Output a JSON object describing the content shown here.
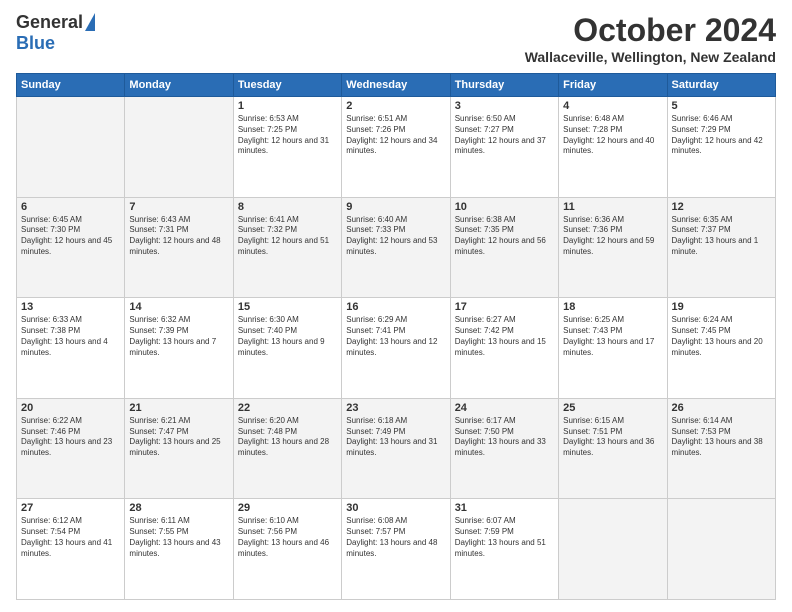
{
  "logo": {
    "general": "General",
    "blue": "Blue"
  },
  "title": {
    "month": "October 2024",
    "location": "Wallaceville, Wellington, New Zealand"
  },
  "weekdays": [
    "Sunday",
    "Monday",
    "Tuesday",
    "Wednesday",
    "Thursday",
    "Friday",
    "Saturday"
  ],
  "weeks": [
    [
      {
        "day": "",
        "info": ""
      },
      {
        "day": "",
        "info": ""
      },
      {
        "day": "1",
        "info": "Sunrise: 6:53 AM\nSunset: 7:25 PM\nDaylight: 12 hours and 31 minutes."
      },
      {
        "day": "2",
        "info": "Sunrise: 6:51 AM\nSunset: 7:26 PM\nDaylight: 12 hours and 34 minutes."
      },
      {
        "day": "3",
        "info": "Sunrise: 6:50 AM\nSunset: 7:27 PM\nDaylight: 12 hours and 37 minutes."
      },
      {
        "day": "4",
        "info": "Sunrise: 6:48 AM\nSunset: 7:28 PM\nDaylight: 12 hours and 40 minutes."
      },
      {
        "day": "5",
        "info": "Sunrise: 6:46 AM\nSunset: 7:29 PM\nDaylight: 12 hours and 42 minutes."
      }
    ],
    [
      {
        "day": "6",
        "info": "Sunrise: 6:45 AM\nSunset: 7:30 PM\nDaylight: 12 hours and 45 minutes."
      },
      {
        "day": "7",
        "info": "Sunrise: 6:43 AM\nSunset: 7:31 PM\nDaylight: 12 hours and 48 minutes."
      },
      {
        "day": "8",
        "info": "Sunrise: 6:41 AM\nSunset: 7:32 PM\nDaylight: 12 hours and 51 minutes."
      },
      {
        "day": "9",
        "info": "Sunrise: 6:40 AM\nSunset: 7:33 PM\nDaylight: 12 hours and 53 minutes."
      },
      {
        "day": "10",
        "info": "Sunrise: 6:38 AM\nSunset: 7:35 PM\nDaylight: 12 hours and 56 minutes."
      },
      {
        "day": "11",
        "info": "Sunrise: 6:36 AM\nSunset: 7:36 PM\nDaylight: 12 hours and 59 minutes."
      },
      {
        "day": "12",
        "info": "Sunrise: 6:35 AM\nSunset: 7:37 PM\nDaylight: 13 hours and 1 minute."
      }
    ],
    [
      {
        "day": "13",
        "info": "Sunrise: 6:33 AM\nSunset: 7:38 PM\nDaylight: 13 hours and 4 minutes."
      },
      {
        "day": "14",
        "info": "Sunrise: 6:32 AM\nSunset: 7:39 PM\nDaylight: 13 hours and 7 minutes."
      },
      {
        "day": "15",
        "info": "Sunrise: 6:30 AM\nSunset: 7:40 PM\nDaylight: 13 hours and 9 minutes."
      },
      {
        "day": "16",
        "info": "Sunrise: 6:29 AM\nSunset: 7:41 PM\nDaylight: 13 hours and 12 minutes."
      },
      {
        "day": "17",
        "info": "Sunrise: 6:27 AM\nSunset: 7:42 PM\nDaylight: 13 hours and 15 minutes."
      },
      {
        "day": "18",
        "info": "Sunrise: 6:25 AM\nSunset: 7:43 PM\nDaylight: 13 hours and 17 minutes."
      },
      {
        "day": "19",
        "info": "Sunrise: 6:24 AM\nSunset: 7:45 PM\nDaylight: 13 hours and 20 minutes."
      }
    ],
    [
      {
        "day": "20",
        "info": "Sunrise: 6:22 AM\nSunset: 7:46 PM\nDaylight: 13 hours and 23 minutes."
      },
      {
        "day": "21",
        "info": "Sunrise: 6:21 AM\nSunset: 7:47 PM\nDaylight: 13 hours and 25 minutes."
      },
      {
        "day": "22",
        "info": "Sunrise: 6:20 AM\nSunset: 7:48 PM\nDaylight: 13 hours and 28 minutes."
      },
      {
        "day": "23",
        "info": "Sunrise: 6:18 AM\nSunset: 7:49 PM\nDaylight: 13 hours and 31 minutes."
      },
      {
        "day": "24",
        "info": "Sunrise: 6:17 AM\nSunset: 7:50 PM\nDaylight: 13 hours and 33 minutes."
      },
      {
        "day": "25",
        "info": "Sunrise: 6:15 AM\nSunset: 7:51 PM\nDaylight: 13 hours and 36 minutes."
      },
      {
        "day": "26",
        "info": "Sunrise: 6:14 AM\nSunset: 7:53 PM\nDaylight: 13 hours and 38 minutes."
      }
    ],
    [
      {
        "day": "27",
        "info": "Sunrise: 6:12 AM\nSunset: 7:54 PM\nDaylight: 13 hours and 41 minutes."
      },
      {
        "day": "28",
        "info": "Sunrise: 6:11 AM\nSunset: 7:55 PM\nDaylight: 13 hours and 43 minutes."
      },
      {
        "day": "29",
        "info": "Sunrise: 6:10 AM\nSunset: 7:56 PM\nDaylight: 13 hours and 46 minutes."
      },
      {
        "day": "30",
        "info": "Sunrise: 6:08 AM\nSunset: 7:57 PM\nDaylight: 13 hours and 48 minutes."
      },
      {
        "day": "31",
        "info": "Sunrise: 6:07 AM\nSunset: 7:59 PM\nDaylight: 13 hours and 51 minutes."
      },
      {
        "day": "",
        "info": ""
      },
      {
        "day": "",
        "info": ""
      }
    ]
  ]
}
